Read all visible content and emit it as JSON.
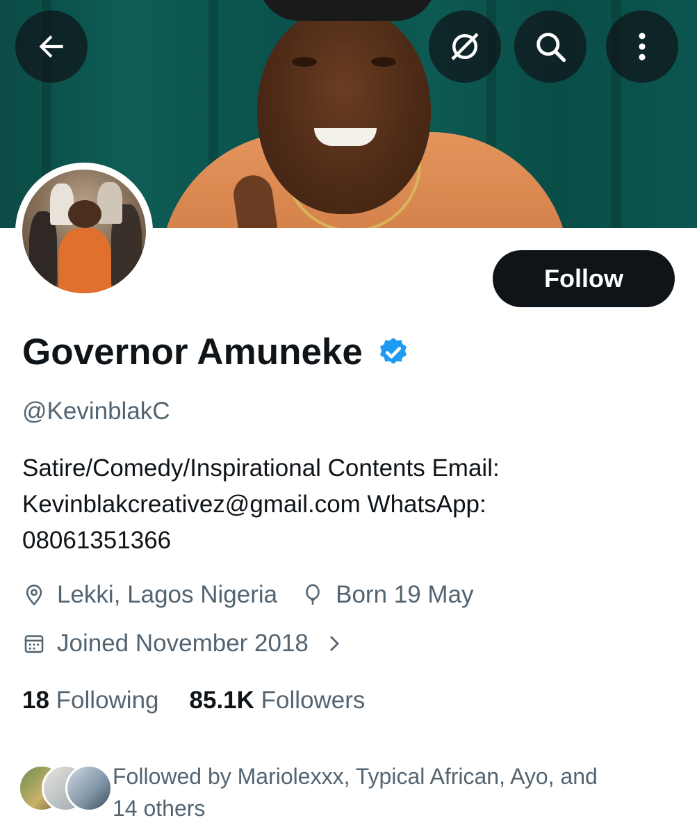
{
  "header": {
    "back_icon": "arrow-left-icon",
    "actions": [
      "translate-off-icon",
      "search-icon",
      "more-vertical-icon"
    ]
  },
  "profile": {
    "name": "Governor Amuneke",
    "verified": true,
    "verified_color": "#1d9bf0",
    "handle": "@KevinblakC",
    "follow_label": "Follow",
    "bio_lines": [
      "Satire/Comedy/Inspirational Contents Email:",
      "Kevinblakcreativez@gmail.com WhatsApp:",
      "08061351366"
    ],
    "location": "Lekki, Lagos  Nigeria",
    "birthday": "Born 19 May",
    "joined": "Joined November 2018"
  },
  "stats": {
    "following_count": "18",
    "following_label": "Following",
    "followers_count": "85.1K",
    "followers_label": "Followers"
  },
  "followed_by": {
    "line1": "Followed by Mariolexxx, Typical African, Ayo, and",
    "line2": "14 others"
  },
  "colors": {
    "text_primary": "#0f1419",
    "text_secondary": "#536471",
    "follow_button_bg": "#0f1419",
    "banner_teal": "#0e5d56"
  }
}
